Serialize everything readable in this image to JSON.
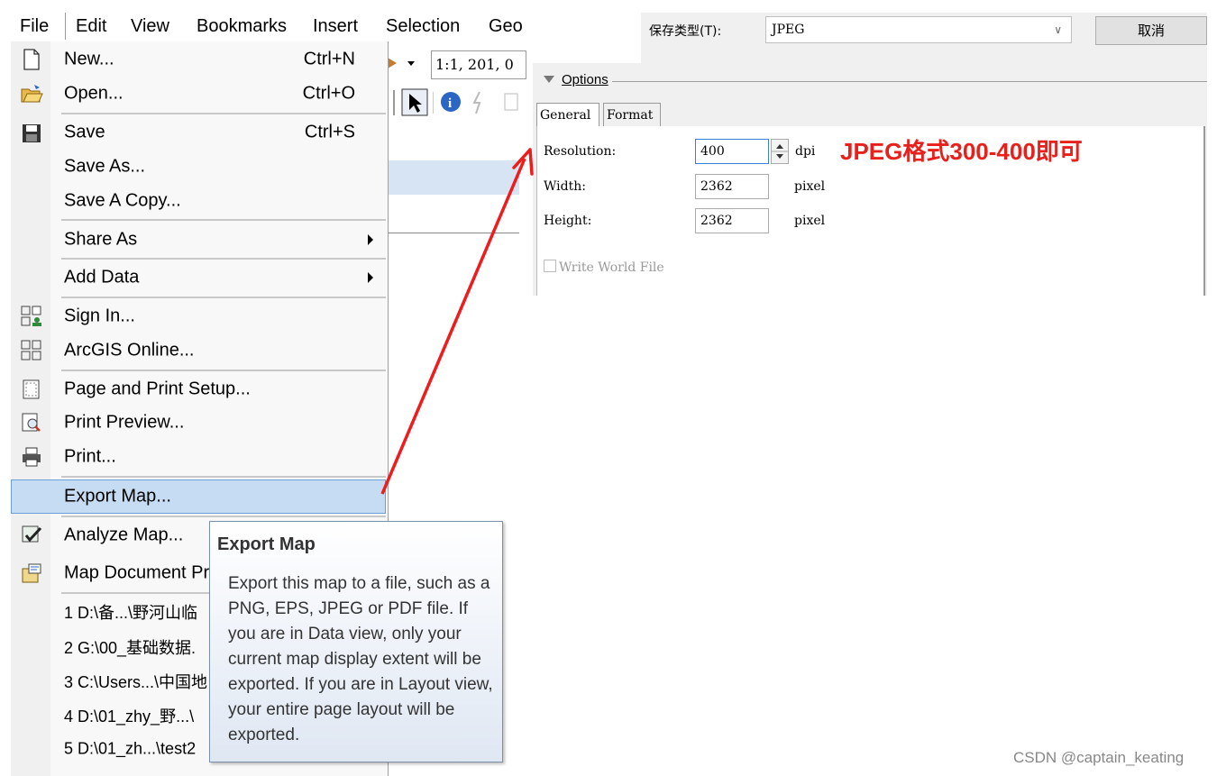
{
  "menubar": {
    "items": [
      "File",
      "Edit",
      "View",
      "Bookmarks",
      "Insert",
      "Selection",
      "Geo"
    ]
  },
  "toolbar": {
    "scale_value": "1:1, 201, 0"
  },
  "file_menu": {
    "items": [
      {
        "label": "New...",
        "shortcut": "Ctrl+N",
        "icon": "new-document-icon"
      },
      {
        "label": "Open...",
        "shortcut": "Ctrl+O",
        "icon": "open-folder-icon"
      },
      {
        "label": "Save",
        "shortcut": "Ctrl+S",
        "icon": "save-disk-icon"
      },
      {
        "label": "Save As...",
        "shortcut": ""
      },
      {
        "label": "Save A Copy...",
        "shortcut": ""
      },
      {
        "label": "Share As",
        "submenu": true
      },
      {
        "label": "Add Data",
        "submenu": true
      },
      {
        "label": "Sign In...",
        "icon": "sign-in-icon"
      },
      {
        "label": "ArcGIS Online...",
        "icon": "arcgis-online-icon"
      },
      {
        "label": "Page and Print Setup...",
        "icon": "page-setup-icon"
      },
      {
        "label": "Print Preview...",
        "icon": "print-preview-icon"
      },
      {
        "label": "Print...",
        "icon": "printer-icon"
      },
      {
        "label": "Export Map...",
        "highlighted": true
      },
      {
        "label": "Analyze Map...",
        "icon": "analyze-map-icon"
      },
      {
        "label": "Map Document Pr",
        "icon": "map-document-properties-icon"
      },
      {
        "label": "1 D:\\备...\\野河山临"
      },
      {
        "label": "2 G:\\00_基础数据."
      },
      {
        "label": "3 C:\\Users...\\中国地"
      },
      {
        "label": "4 D:\\01_zhy_野...\\"
      },
      {
        "label": "5 D:\\01_zh...\\test2"
      }
    ]
  },
  "tooltip": {
    "title": "Export Map",
    "body": "Export this map to a file, such as a PNG, EPS, JPEG or PDF file. If you are in Data view, only your current map display extent will be exported. If you are in Layout view, your entire page layout will be exported."
  },
  "dialog": {
    "save_type_label": "保存类型(T):",
    "save_type_value": "JPEG",
    "cancel_label": "取消",
    "options_label": "Options",
    "tabs": [
      "General",
      "Format"
    ],
    "fields": [
      {
        "label": "Resolution:",
        "value": "400",
        "unit": "dpi"
      },
      {
        "label": "Width:",
        "value": "2362",
        "unit": "pixel"
      },
      {
        "label": "Height:",
        "value": "2362",
        "unit": "pixel"
      }
    ],
    "write_world_file_label": "Write World File",
    "write_world_file_checked": false
  },
  "annotation": {
    "note": "JPEG格式300-400即可",
    "color": "#e8201c"
  },
  "watermark": "CSDN @captain_keating"
}
